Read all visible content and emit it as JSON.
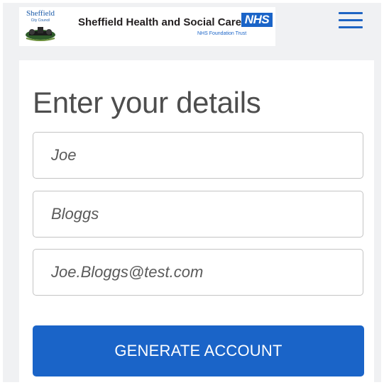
{
  "header": {
    "council_name": "Sheffield",
    "council_subtitle": "City Council",
    "trust_name": "Sheffield Health and Social Care",
    "nhs_badge": "NHS",
    "trust_subtitle": "NHS Foundation Trust"
  },
  "menu": {
    "icon": "hamburger-menu-icon"
  },
  "form": {
    "heading": "Enter your details",
    "first_name": {
      "placeholder": "Joe"
    },
    "last_name": {
      "placeholder": "Bloggs"
    },
    "email": {
      "placeholder": "Joe.Bloggs@test.com"
    },
    "submit_label": "GENERATE ACCOUNT"
  },
  "colors": {
    "accent": "#1a64c8",
    "heading_text": "#4d4d4d",
    "page_background": "#f0f1f3"
  }
}
